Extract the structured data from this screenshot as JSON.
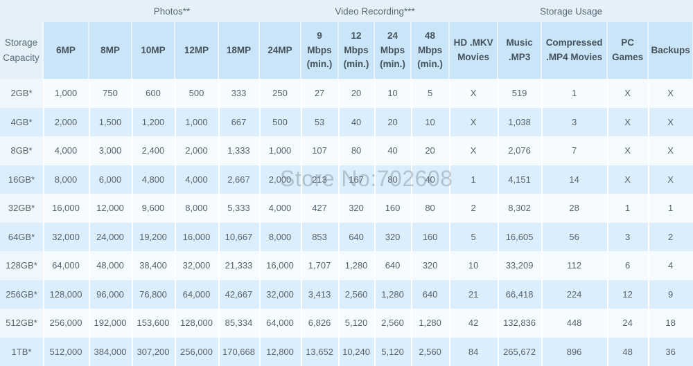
{
  "watermark": {
    "text": "Store No:702608"
  },
  "table": {
    "corner_header": {
      "line1": "Storage",
      "line2": "Capacity"
    },
    "groups": [
      {
        "label": "",
        "span": 1
      },
      {
        "label": "Photos**",
        "span": 6
      },
      {
        "label": "Video Recording***",
        "span": 4
      },
      {
        "label": "Storage Usage",
        "span": 5
      }
    ],
    "columns": [
      {
        "key": "capacity",
        "line1": "Storage",
        "line2": "Capacity",
        "line3": ""
      },
      {
        "key": "6mp",
        "line1": "6MP",
        "line2": "",
        "line3": ""
      },
      {
        "key": "8mp",
        "line1": "8MP",
        "line2": "",
        "line3": ""
      },
      {
        "key": "10mp",
        "line1": "10MP",
        "line2": "",
        "line3": ""
      },
      {
        "key": "12mp",
        "line1": "12MP",
        "line2": "",
        "line3": ""
      },
      {
        "key": "18mp",
        "line1": "18MP",
        "line2": "",
        "line3": ""
      },
      {
        "key": "24mp",
        "line1": "24MP",
        "line2": "",
        "line3": ""
      },
      {
        "key": "9mbps",
        "line1": "9",
        "line2": "Mbps",
        "line3": "(min.)"
      },
      {
        "key": "12mbps",
        "line1": "12",
        "line2": "Mbps",
        "line3": "(min.)"
      },
      {
        "key": "24mbps",
        "line1": "24",
        "line2": "Mbps",
        "line3": "(min.)"
      },
      {
        "key": "48mbps",
        "line1": "48",
        "line2": "Mbps",
        "line3": "(min.)"
      },
      {
        "key": "mkv",
        "line1": "HD .MKV",
        "line2": "Movies",
        "line3": ""
      },
      {
        "key": "mp3",
        "line1": "Music",
        "line2": ".MP3",
        "line3": ""
      },
      {
        "key": "mp4",
        "line1": "Compressed",
        "line2": ".MP4 Movies",
        "line3": ""
      },
      {
        "key": "pcgames",
        "line1": "PC",
        "line2": "Games",
        "line3": ""
      },
      {
        "key": "backups",
        "line1": "Backups",
        "line2": "",
        "line3": ""
      }
    ],
    "rows": [
      {
        "cells": [
          "2GB*",
          "1,000",
          "750",
          "600",
          "500",
          "333",
          "250",
          "27",
          "20",
          "10",
          "5",
          "X",
          "519",
          "1",
          "X",
          "X"
        ]
      },
      {
        "cells": [
          "4GB*",
          "2,000",
          "1,500",
          "1,200",
          "1,000",
          "667",
          "500",
          "53",
          "40",
          "20",
          "10",
          "X",
          "1,038",
          "3",
          "X",
          "X"
        ]
      },
      {
        "cells": [
          "8GB*",
          "4,000",
          "3,000",
          "2,400",
          "2,000",
          "1,333",
          "1,000",
          "107",
          "80",
          "40",
          "20",
          "X",
          "2,076",
          "7",
          "X",
          "X"
        ]
      },
      {
        "cells": [
          "16GB*",
          "8,000",
          "6,000",
          "4,800",
          "4,000",
          "2,667",
          "2,000",
          "213",
          "167",
          "80",
          "40",
          "1",
          "4,151",
          "14",
          "X",
          "X"
        ]
      },
      {
        "cells": [
          "32GB*",
          "16,000",
          "12,000",
          "9,600",
          "8,000",
          "5,333",
          "4,000",
          "427",
          "320",
          "160",
          "80",
          "2",
          "8,302",
          "28",
          "1",
          "1"
        ]
      },
      {
        "cells": [
          "64GB*",
          "32,000",
          "24,000",
          "19,200",
          "16,000",
          "10,667",
          "8,000",
          "853",
          "640",
          "320",
          "160",
          "5",
          "16,605",
          "56",
          "3",
          "2"
        ]
      },
      {
        "cells": [
          "128GB*",
          "64,000",
          "48,000",
          "38,400",
          "32,000",
          "21,333",
          "16,000",
          "1,707",
          "1,280",
          "640",
          "320",
          "10",
          "33,209",
          "112",
          "6",
          "4"
        ]
      },
      {
        "cells": [
          "256GB*",
          "128,000",
          "96,000",
          "76,800",
          "64,000",
          "42,667",
          "32,000",
          "3,413",
          "2,560",
          "1,280",
          "640",
          "21",
          "66,418",
          "224",
          "12",
          "9"
        ]
      },
      {
        "cells": [
          "512GB*",
          "256,000",
          "192,000",
          "153,600",
          "128,000",
          "85,334",
          "64,000",
          "6,826",
          "5,120",
          "2,560",
          "1,280",
          "42",
          "132,836",
          "448",
          "24",
          "18"
        ]
      },
      {
        "cells": [
          "1TB*",
          "512,000",
          "384,000",
          "307,200",
          "256,000",
          "170,668",
          "12,800",
          "13,652",
          "10,240",
          "5,120",
          "2,560",
          "84",
          "265,672",
          "896",
          "48",
          "36"
        ]
      }
    ]
  }
}
